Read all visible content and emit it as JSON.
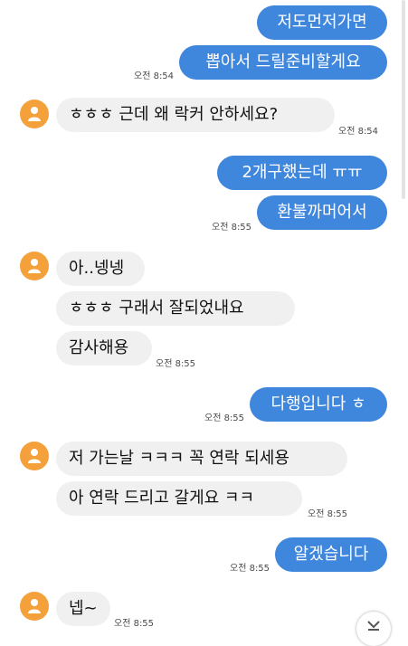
{
  "messages": [
    {
      "text": "저도먼저가면"
    },
    {
      "text": "뽑아서 드릴준비할게요",
      "time": "오전 8:54"
    },
    {
      "text": "ㅎㅎㅎ 근데 왜 락커 안하세요?",
      "time": "오전 8:54"
    },
    {
      "text": "2개구했는데 ㅠㅠ"
    },
    {
      "text": "환불까머어서",
      "time": "오전 8:55"
    },
    {
      "text": "아..넹넹"
    },
    {
      "text": "ㅎㅎㅎ 구래서 잘되었내요"
    },
    {
      "text": "감사해용",
      "time": "오전 8:55"
    },
    {
      "text": "다행입니다 ㅎ",
      "time": "오전 8:55"
    },
    {
      "text": "저 가는날 ㅋㅋㅋ 꼭 연락 되세용"
    },
    {
      "text": "아 연락 드리고 갈게요 ㅋㅋ",
      "time": "오전 8:55"
    },
    {
      "text": "알겠습니다",
      "time": "오전 8:55"
    },
    {
      "text": "넵~",
      "time": "오전 8:55"
    }
  ],
  "icons": {
    "avatar": "person-icon",
    "scroll_down": "chevron-down-icon"
  },
  "colors": {
    "outgoing_bubble": "#3f86dd",
    "incoming_bubble": "#f0f0f0",
    "avatar": "#f4a13b"
  }
}
